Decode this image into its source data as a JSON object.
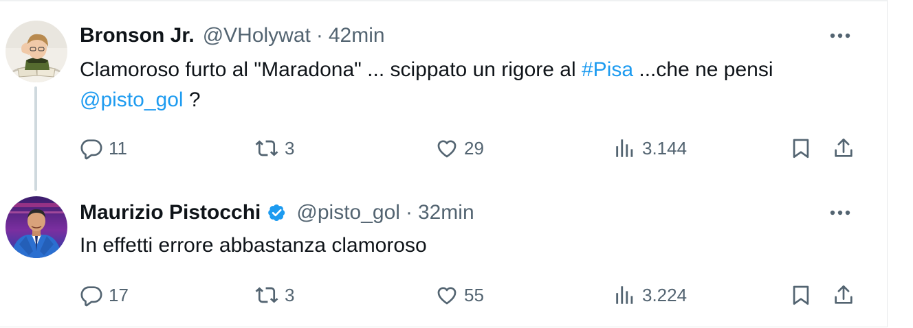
{
  "thread": [
    {
      "author": {
        "name": "Bronson Jr.",
        "handle": "@VHolywat",
        "verified": false,
        "avatar_icon": "avatar-child-reading"
      },
      "separator": "·",
      "time": "42min",
      "text_parts": {
        "p1": "Clamoroso furto al \"Maradona\" ... scippato un rigore al ",
        "hashtag": "#Pisa",
        "p2": " ...che ne pensi ",
        "mention": "@pisto_gol",
        "p3": " ?"
      },
      "metrics": {
        "replies": "11",
        "reposts": "3",
        "likes": "29",
        "views": "3.144"
      }
    },
    {
      "author": {
        "name": "Maurizio Pistocchi",
        "handle": "@pisto_gol",
        "verified": true,
        "avatar_icon": "avatar-man-blue-suit"
      },
      "separator": "·",
      "time": "32min",
      "text": "In effetti errore abbastanza clamoroso",
      "metrics": {
        "replies": "17",
        "reposts": "3",
        "likes": "55",
        "views": "3.224"
      }
    }
  ],
  "icons": {
    "more": "more-horizontal-icon",
    "reply": "reply-icon",
    "repost": "repost-icon",
    "like": "heart-icon",
    "views": "views-chart-icon",
    "bookmark": "bookmark-icon",
    "share": "share-icon",
    "verified": "verified-badge-icon"
  },
  "colors": {
    "text": "#0f1419",
    "secondary": "#536471",
    "accent": "#1d9bf0",
    "thread_line": "#cfd9de"
  }
}
